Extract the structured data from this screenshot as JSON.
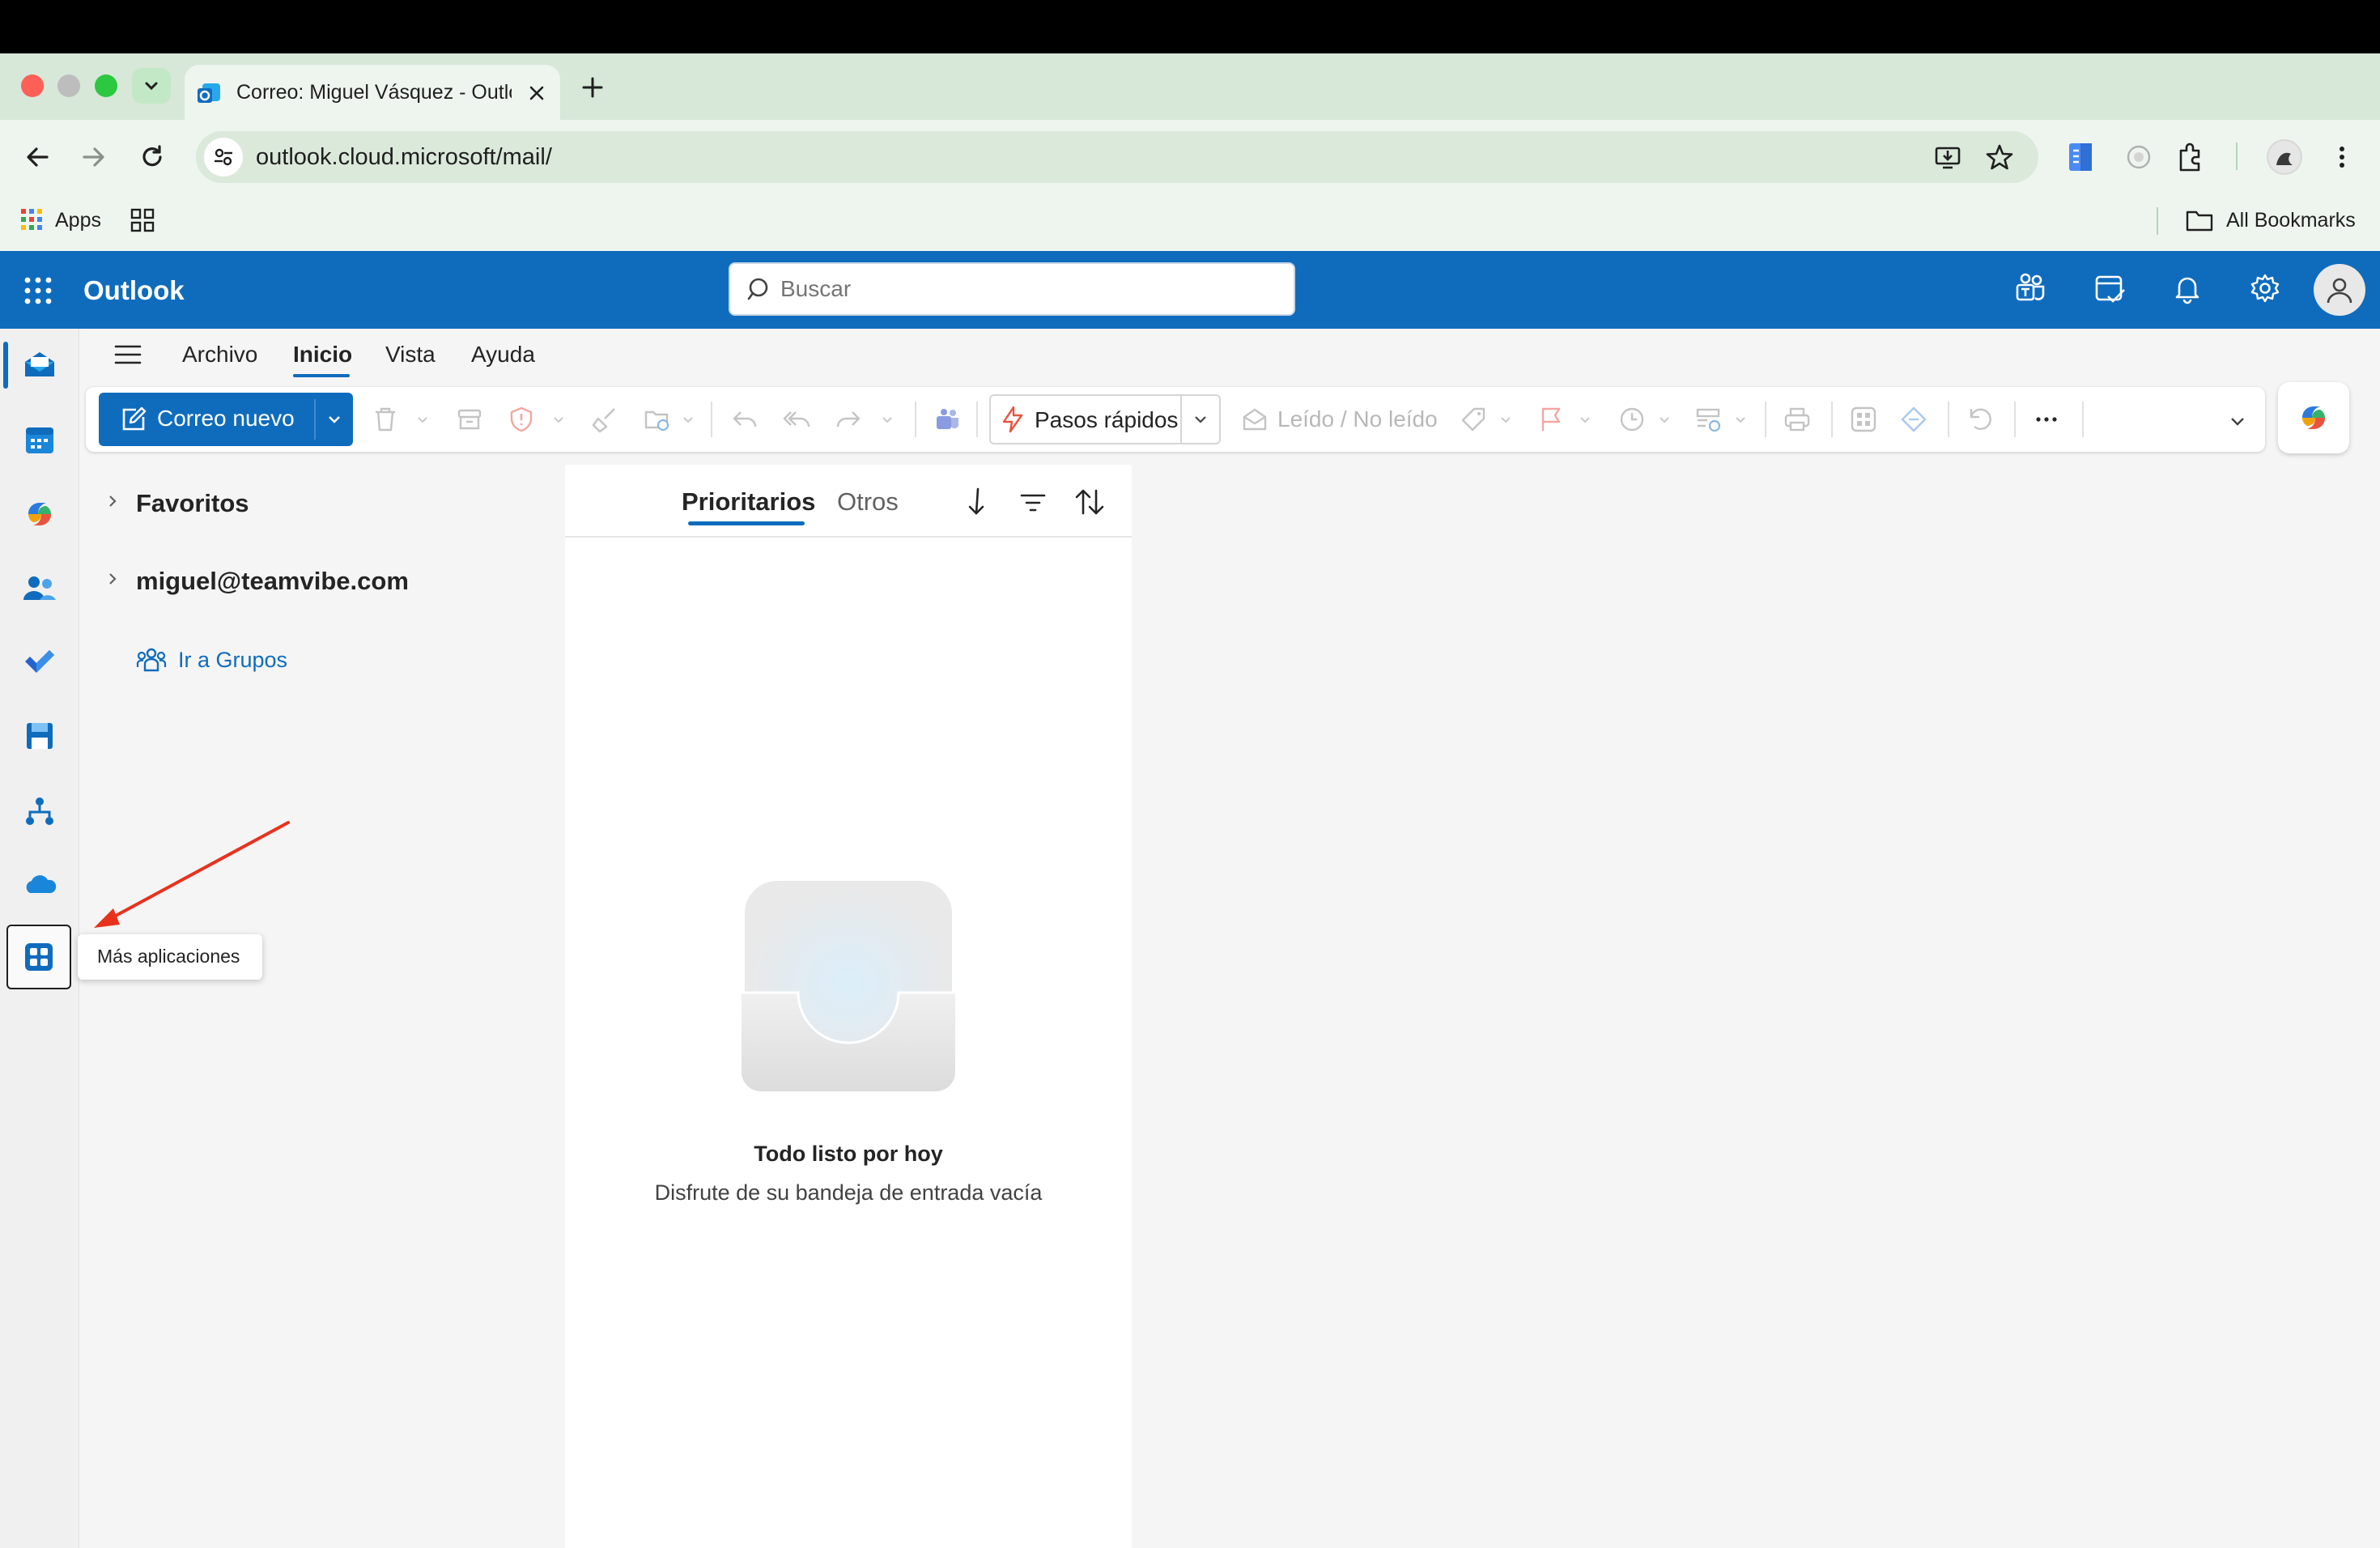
{
  "browser": {
    "tab_title": "Correo: Miguel Vásquez - Outlook",
    "url": "outlook.cloud.microsoft/mail/",
    "bookmarks_apps_label": "Apps",
    "all_bookmarks_label": "All Bookmarks"
  },
  "outlook": {
    "app_name": "Outlook",
    "search_placeholder": "Buscar",
    "menu_tabs": [
      "Archivo",
      "Inicio",
      "Vista",
      "Ayuda"
    ],
    "active_menu_tab": "Inicio",
    "new_mail_label": "Correo nuevo",
    "quick_steps_label": "Pasos rápidos",
    "read_unread_label": "Leído / No leído",
    "folders": {
      "favorites_label": "Favoritos",
      "account_label": "miguel@teamvibe.com",
      "groups_link": "Ir a Grupos"
    },
    "mail_list": {
      "tabs": [
        "Prioritarios",
        "Otros"
      ],
      "active_tab": "Prioritarios",
      "empty_title": "Todo listo por hoy",
      "empty_subtitle": "Disfrute de su bandeja de entrada vacía"
    },
    "tooltip": "Más aplicaciones",
    "accent_color": "#0f6cbd",
    "annotation_arrow_color": "#e8321e"
  }
}
